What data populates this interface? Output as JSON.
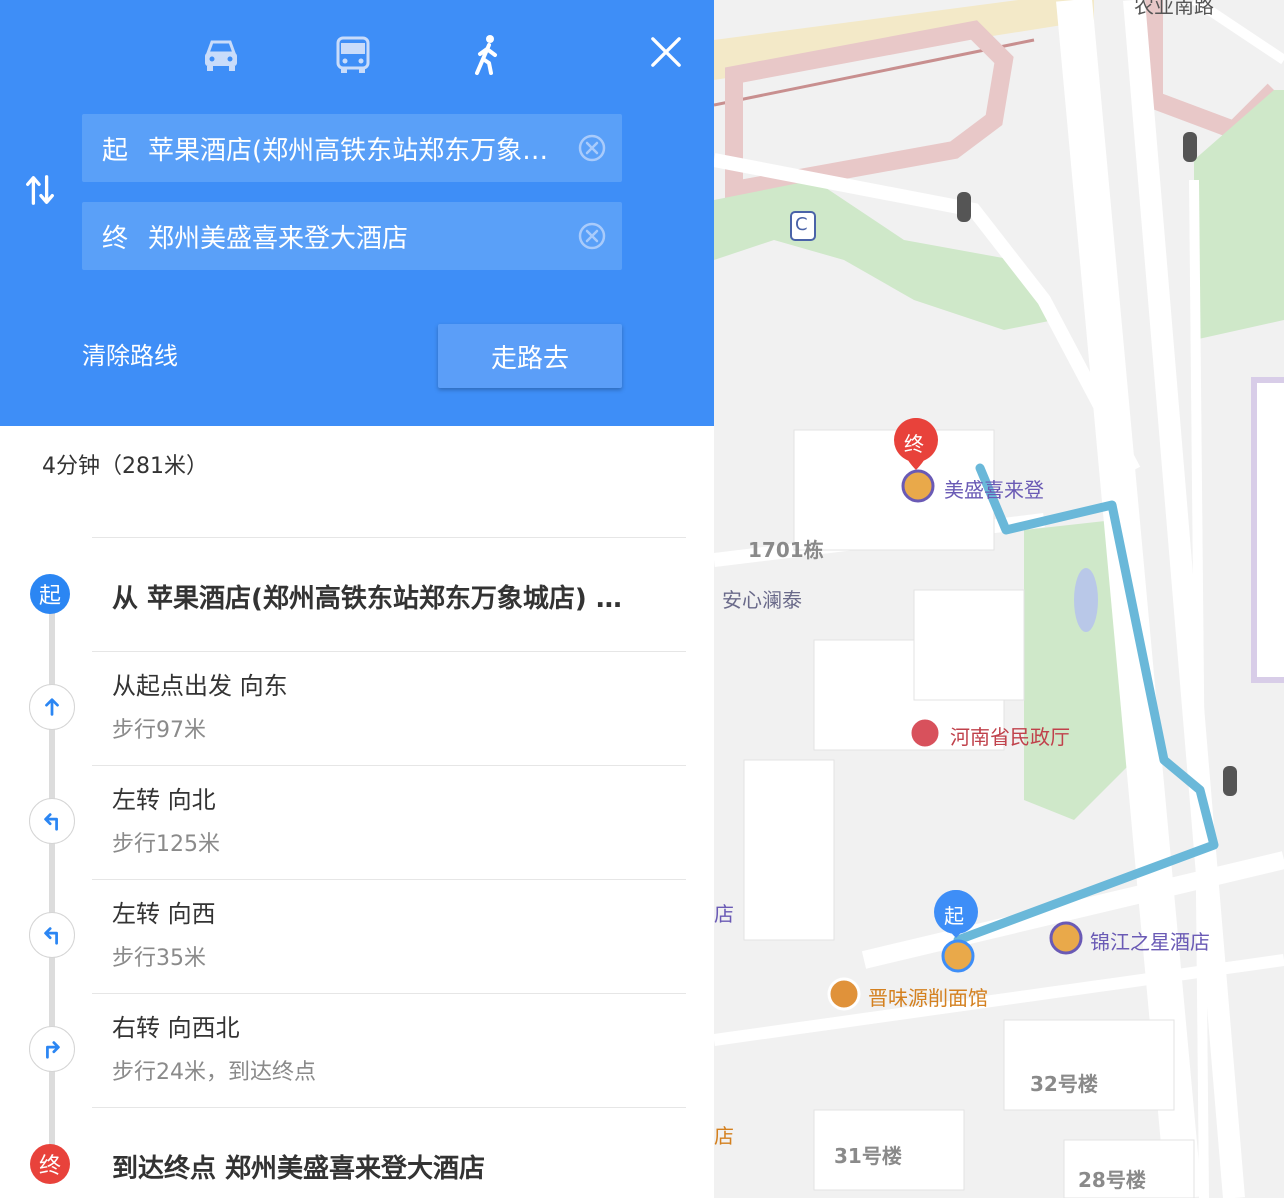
{
  "header": {
    "modes": [
      {
        "name": "car",
        "icon": "car-icon"
      },
      {
        "name": "bus",
        "icon": "bus-icon"
      },
      {
        "name": "walk",
        "icon": "walk-icon",
        "selected": true
      }
    ],
    "start_tag": "起",
    "start_value": "苹果酒店(郑州高铁东站郑东万象城店)",
    "end_tag": "终",
    "end_value": "郑州美盛喜来登大酒店",
    "clear_route_label": "清除路线",
    "go_label": "走路去",
    "swap_label": "↑↓"
  },
  "summary": "4分钟（281米）",
  "route": {
    "start_badge": "起",
    "start_title": "从 苹果酒店(郑州高铁东站郑东万象城店) …",
    "steps": [
      {
        "main": "从起点出发 向东",
        "sub": "步行97米",
        "icon": "straight-arrow-icon"
      },
      {
        "main": "左转 向北",
        "sub": "步行125米",
        "icon": "turn-left-icon"
      },
      {
        "main": "左转 向西",
        "sub": "步行35米",
        "icon": "turn-left-icon"
      },
      {
        "main": "右转 向西北",
        "sub": "步行24米，到达终点",
        "icon": "turn-right-icon"
      }
    ],
    "end_badge": "终",
    "end_title": "到达终点 郑州美盛喜来登大酒店"
  },
  "map": {
    "labels": {
      "top_road": "农业南路",
      "metro": "C",
      "building_1701": "1701栋",
      "anxin": "安心澜泰",
      "end_marker": "终",
      "end_poi": "美盛喜来登",
      "civil_affairs": "河南省民政厅",
      "start_marker": "起",
      "jinjiang": "锦江之星酒店",
      "noodle": "晋味源削面馆",
      "b32": "32号楼",
      "b31": "31号楼",
      "b28": "28号楼",
      "edge_1": "店",
      "edge_2": "店"
    },
    "colors": {
      "route": "#6ab8d9",
      "end_marker": "#e8423b",
      "start_marker": "#3e8ef7",
      "poi_text": "#6a5ab5",
      "gov_text": "#c0414b",
      "food_text": "#d4801f"
    }
  }
}
